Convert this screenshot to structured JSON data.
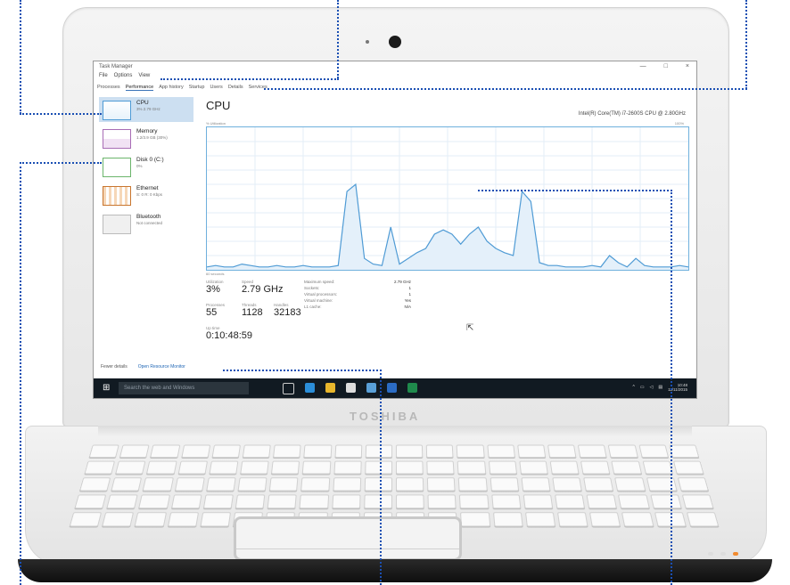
{
  "laptop": {
    "brand": "TOSHIBA"
  },
  "task_manager": {
    "title": "Task Manager",
    "window_buttons": [
      "—",
      "□",
      "×"
    ],
    "menu": [
      "File",
      "Options",
      "View"
    ],
    "tabs": [
      "Processes",
      "Performance",
      "App history",
      "Startup",
      "Users",
      "Details",
      "Services"
    ],
    "active_tab": "Performance",
    "sidebar": [
      {
        "name": "CPU",
        "sub": "3% 2.79 GHz",
        "selected": true
      },
      {
        "name": "Memory",
        "sub": "1.2/3.9 GB (30%)"
      },
      {
        "name": "Disk 0 (C:)",
        "sub": "0%"
      },
      {
        "name": "Ethernet",
        "sub": "S: 0 R: 0 Kbps"
      },
      {
        "name": "Bluetooth",
        "sub": "Not connected"
      }
    ],
    "cpu_title": "CPU",
    "cpu_model": "Intel(R) Core(TM) i7-2600S CPU @ 2.80GHz",
    "util_label": "% Utilization",
    "pct_label": "100%",
    "secs_label": "60 seconds",
    "stats": {
      "utilization_label": "Utilization",
      "utilization": "3%",
      "speed_label": "Speed",
      "speed": "2.79 GHz",
      "processes_label": "Processes",
      "processes": "55",
      "threads_label": "Threads",
      "threads": "1128",
      "handles_label": "Handles",
      "handles": "32183",
      "uptime_label": "Up time",
      "uptime": "0:10:48:59"
    },
    "details": [
      {
        "k": "Maximum speed:",
        "v": "2.79 GHz"
      },
      {
        "k": "Sockets:",
        "v": "1"
      },
      {
        "k": "Virtual processors:",
        "v": "1"
      },
      {
        "k": "Virtual machine:",
        "v": "Yes"
      },
      {
        "k": "L1 cache:",
        "v": "N/A"
      }
    ],
    "footer": {
      "fewer": "Fewer details",
      "monitor": "Open Resource Monitor"
    },
    "graph_series": [
      2,
      3,
      2,
      2,
      4,
      3,
      2,
      2,
      3,
      2,
      2,
      3,
      2,
      2,
      2,
      3,
      55,
      60,
      8,
      4,
      3,
      30,
      4,
      8,
      12,
      15,
      25,
      28,
      25,
      18,
      25,
      30,
      20,
      15,
      12,
      10,
      55,
      48,
      5,
      3,
      3,
      2,
      2,
      2,
      3,
      2,
      10,
      5,
      2,
      8,
      3,
      2,
      2,
      2,
      3,
      2
    ]
  },
  "taskbar": {
    "search_placeholder": "Search the web and Windows",
    "time": "10:48",
    "date": "11/11/2015"
  },
  "colors": {
    "accent": "#1a4fb3",
    "graph_line": "#4f9bd5",
    "taskbar": "#111a22"
  }
}
